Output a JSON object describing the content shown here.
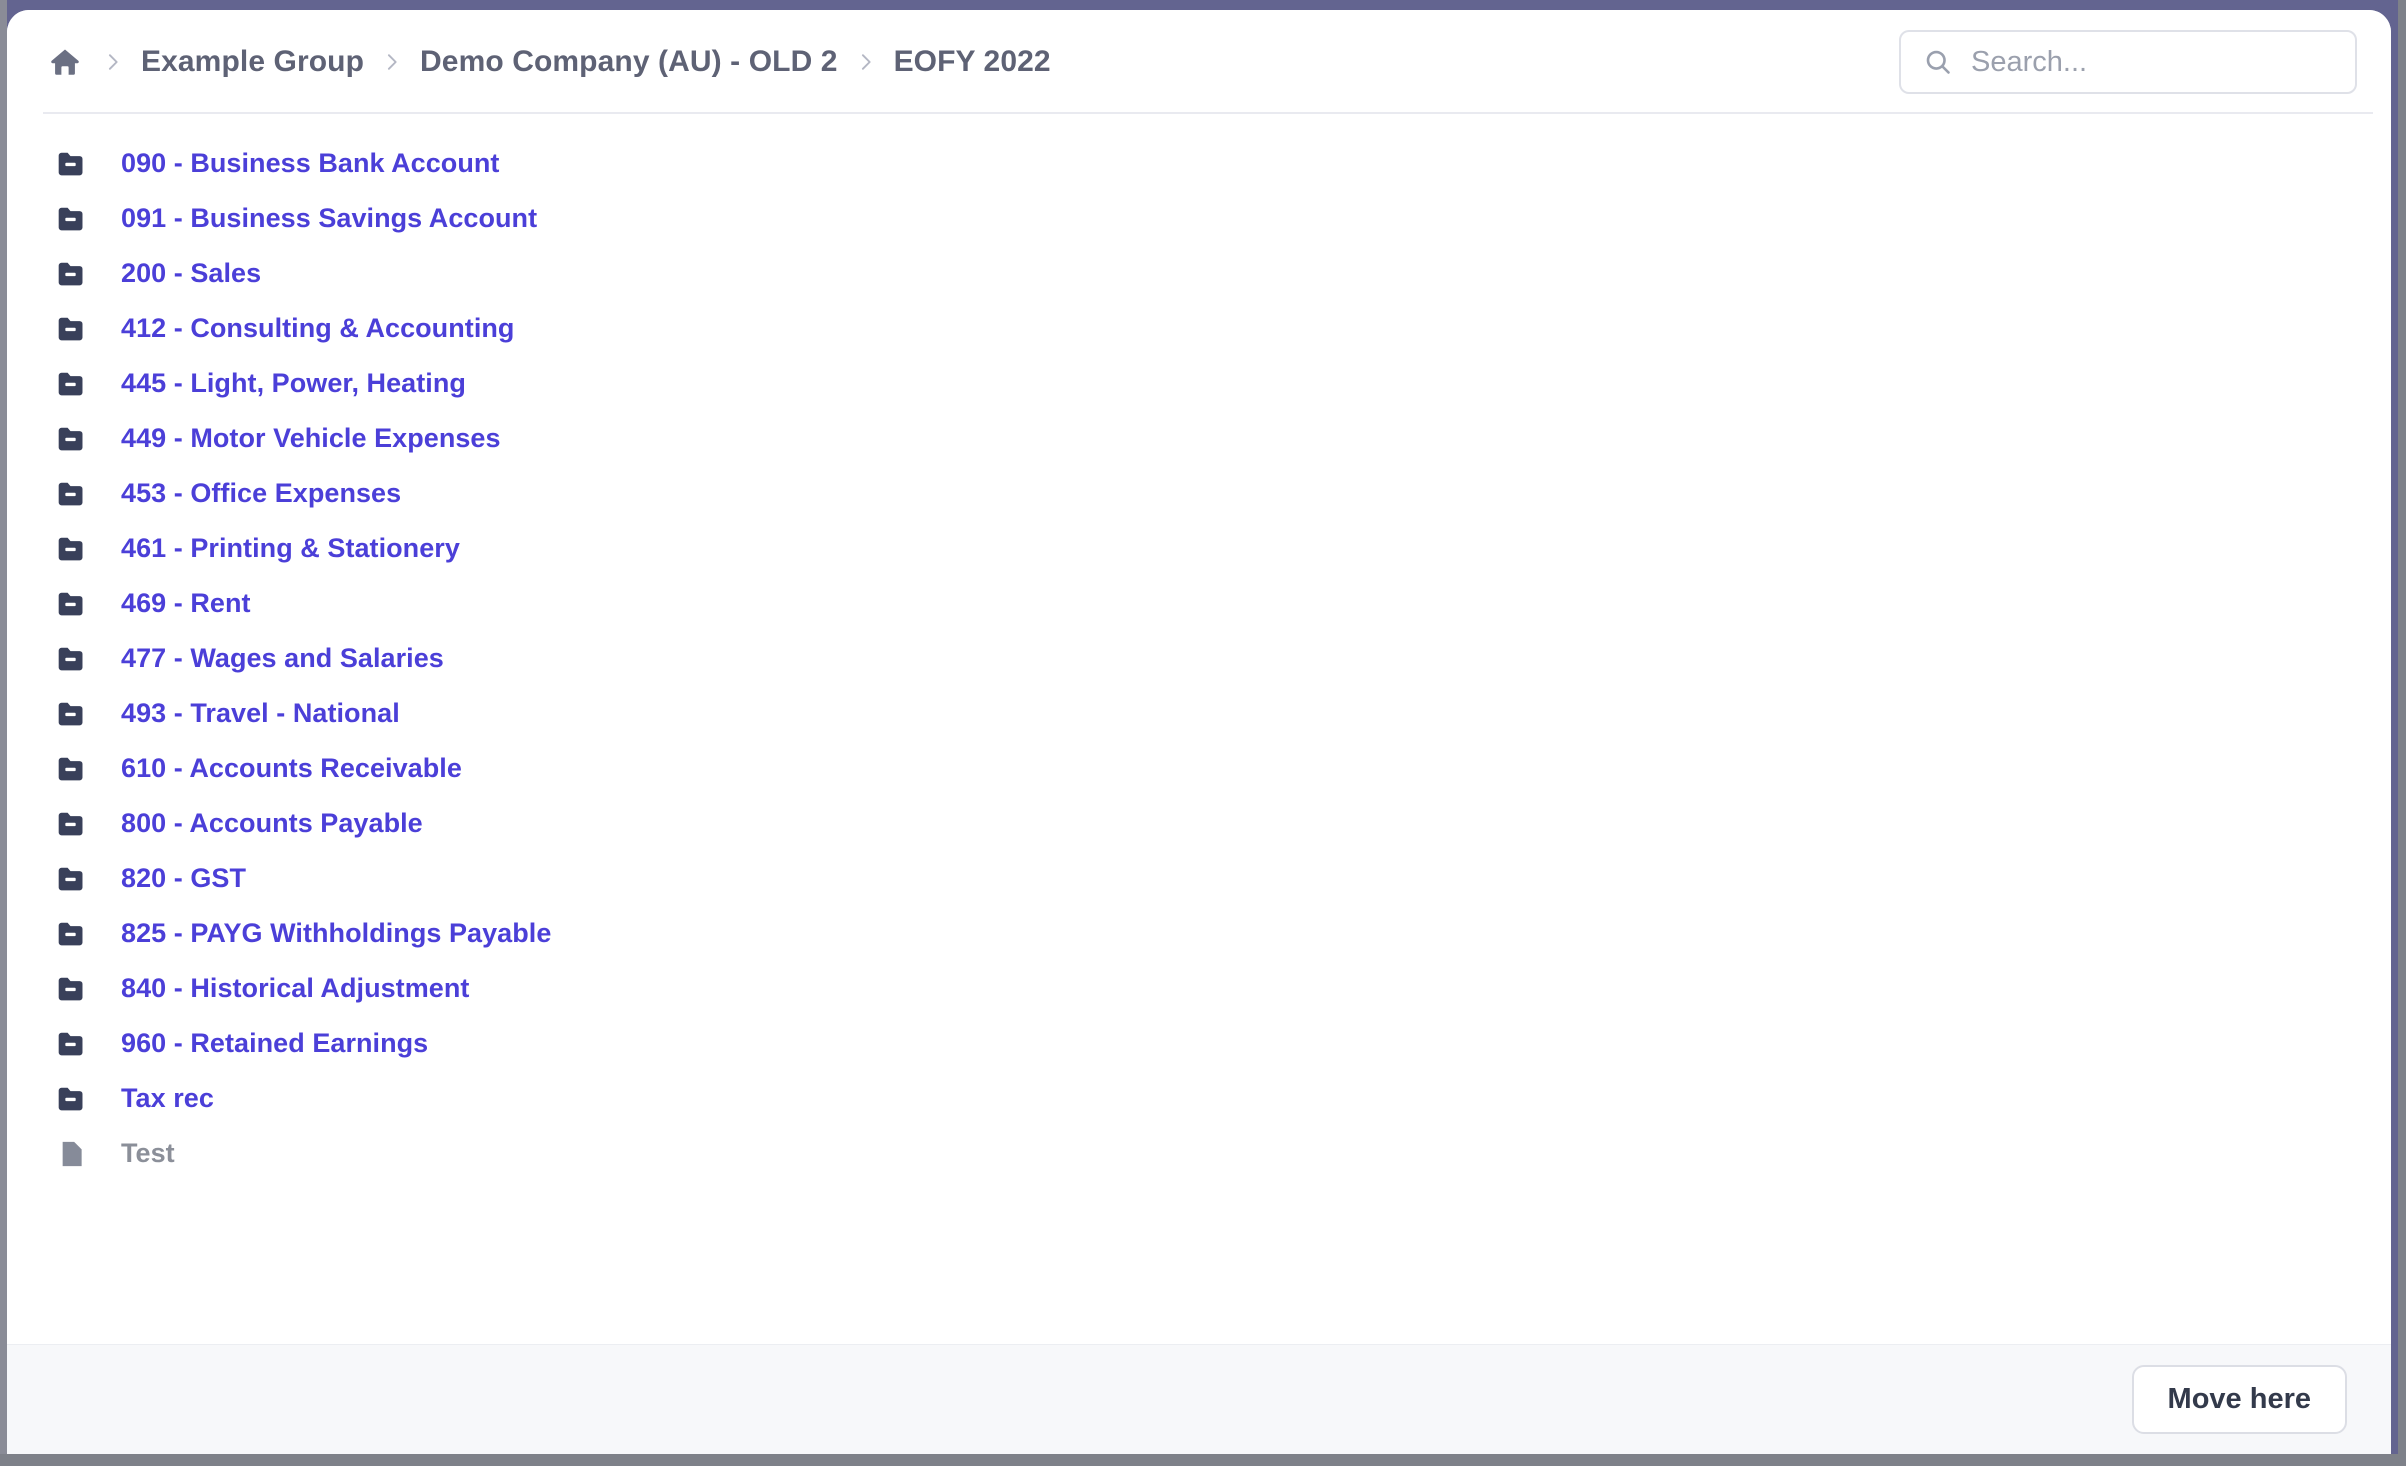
{
  "colors": {
    "backdrop": "#636490",
    "link": "#4b3fd8",
    "folder_icon": "#39405a",
    "file_icon": "#868b99",
    "breadcrumb_text": "#5e6275",
    "footer_bg": "#f7f8fa",
    "frame_bar": "#7e8189"
  },
  "header": {
    "home_icon": "home-icon",
    "separator": "›",
    "breadcrumbs": [
      {
        "label": "Example Group",
        "current": false
      },
      {
        "label": "Demo Company (AU) - OLD 2",
        "current": false
      },
      {
        "label": "EOFY 2022",
        "current": true
      }
    ]
  },
  "search": {
    "icon": "search-icon",
    "placeholder": "Search...",
    "value": ""
  },
  "list": {
    "items": [
      {
        "label": "090 - Business Bank Account",
        "type": "folder",
        "state": "enabled"
      },
      {
        "label": "091 - Business Savings Account",
        "type": "folder",
        "state": "enabled"
      },
      {
        "label": "200 - Sales",
        "type": "folder",
        "state": "enabled"
      },
      {
        "label": "412 - Consulting & Accounting",
        "type": "folder",
        "state": "enabled"
      },
      {
        "label": "445 - Light, Power, Heating",
        "type": "folder",
        "state": "enabled"
      },
      {
        "label": "449 - Motor Vehicle Expenses",
        "type": "folder",
        "state": "enabled"
      },
      {
        "label": "453 - Office Expenses",
        "type": "folder",
        "state": "enabled"
      },
      {
        "label": "461 - Printing & Stationery",
        "type": "folder",
        "state": "enabled"
      },
      {
        "label": "469 - Rent",
        "type": "folder",
        "state": "enabled"
      },
      {
        "label": "477 - Wages and Salaries",
        "type": "folder",
        "state": "enabled"
      },
      {
        "label": "493 - Travel - National",
        "type": "folder",
        "state": "enabled"
      },
      {
        "label": "610 - Accounts Receivable",
        "type": "folder",
        "state": "enabled"
      },
      {
        "label": "800 - Accounts Payable",
        "type": "folder",
        "state": "enabled"
      },
      {
        "label": "820 - GST",
        "type": "folder",
        "state": "enabled"
      },
      {
        "label": "825 - PAYG Withholdings Payable",
        "type": "folder",
        "state": "enabled"
      },
      {
        "label": "840 - Historical Adjustment",
        "type": "folder",
        "state": "enabled"
      },
      {
        "label": "960 - Retained Earnings",
        "type": "folder",
        "state": "enabled"
      },
      {
        "label": "Tax rec",
        "type": "folder",
        "state": "enabled"
      },
      {
        "label": "Test",
        "type": "file",
        "state": "disabled"
      }
    ]
  },
  "footer": {
    "move_button_label": "Move here"
  }
}
